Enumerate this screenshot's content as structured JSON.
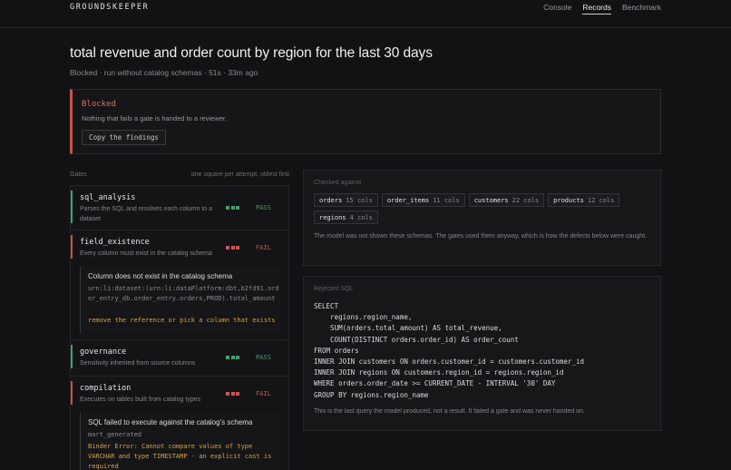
{
  "app": {
    "brand": "GROUNDSKEEPER"
  },
  "nav": {
    "items": [
      {
        "label": "Console",
        "active": false
      },
      {
        "label": "Records",
        "active": true
      },
      {
        "label": "Benchmark",
        "active": false
      }
    ]
  },
  "header": {
    "title": "total revenue and order count by region for the last 30 days",
    "subtitle": "Blocked · run without catalog schemas · 51s · 33m ago"
  },
  "banner": {
    "title": "Blocked",
    "text": "Nothing that fails a gate is handed to a reviewer.",
    "button": "Copy the findings"
  },
  "gates": {
    "label": "Gates",
    "hint": "one square per attempt, oldest first",
    "items": [
      {
        "name": "sql_analysis",
        "desc": "Parses the SQL and resolves each column to a dataset",
        "status": "PASS",
        "attempts": 3
      },
      {
        "name": "field_existence",
        "desc": "Every column must exist in the catalog schema",
        "status": "FAIL",
        "attempts": 3,
        "finding": {
          "title": "Column does not exist in the catalog schema",
          "ref": "urn:li:dataset:(urn:li:dataPlatform:dbt,b2fd91.order_entry_db.order_entry.orders,PROD).total_amount",
          "fix": "remove the reference or pick a column that exists"
        }
      },
      {
        "name": "governance",
        "desc": "Sensitivity inherited from source columns",
        "status": "PASS",
        "attempts": 3
      },
      {
        "name": "compilation",
        "desc": "Executes on tables built from catalog types",
        "status": "FAIL",
        "attempts": 3,
        "finding": {
          "title": "SQL failed to execute against the catalog's schema",
          "ref": "mart_generated",
          "fix": "Binder Error: Cannot compare values of type VARCHAR and type TIMESTAMP - an explicit cast is required"
        }
      }
    ]
  },
  "checked": {
    "label": "Checked against",
    "tables": [
      {
        "name": "orders",
        "cols": "15 cols"
      },
      {
        "name": "order_items",
        "cols": "11 cols"
      },
      {
        "name": "customers",
        "cols": "22 cols"
      },
      {
        "name": "products",
        "cols": "12 cols"
      },
      {
        "name": "regions",
        "cols": "4 cols"
      }
    ],
    "note": "The model was not shown these schemas. The gates used them anyway, which is how the defects below were caught."
  },
  "rejected": {
    "label": "Rejected SQL",
    "sql": "SELECT\n    regions.region_name,\n    SUM(orders.total_amount) AS total_revenue,\n    COUNT(DISTINCT orders.order_id) AS order_count\nFROM orders\nINNER JOIN customers ON orders.customer_id = customers.customer_id\nINNER JOIN regions ON customers.region_id = regions.region_id\nWHERE orders.order_date >= CURRENT_DATE - INTERVAL '30' DAY\nGROUP BY regions.region_name",
    "note": "This is the last query the model produced, not a result. It failed a gate and was never handed on."
  },
  "colors": {
    "pass": "#3fa06a",
    "fail": "#d0554f",
    "fix": "#d9a04a",
    "blocked": "#e06a64"
  }
}
